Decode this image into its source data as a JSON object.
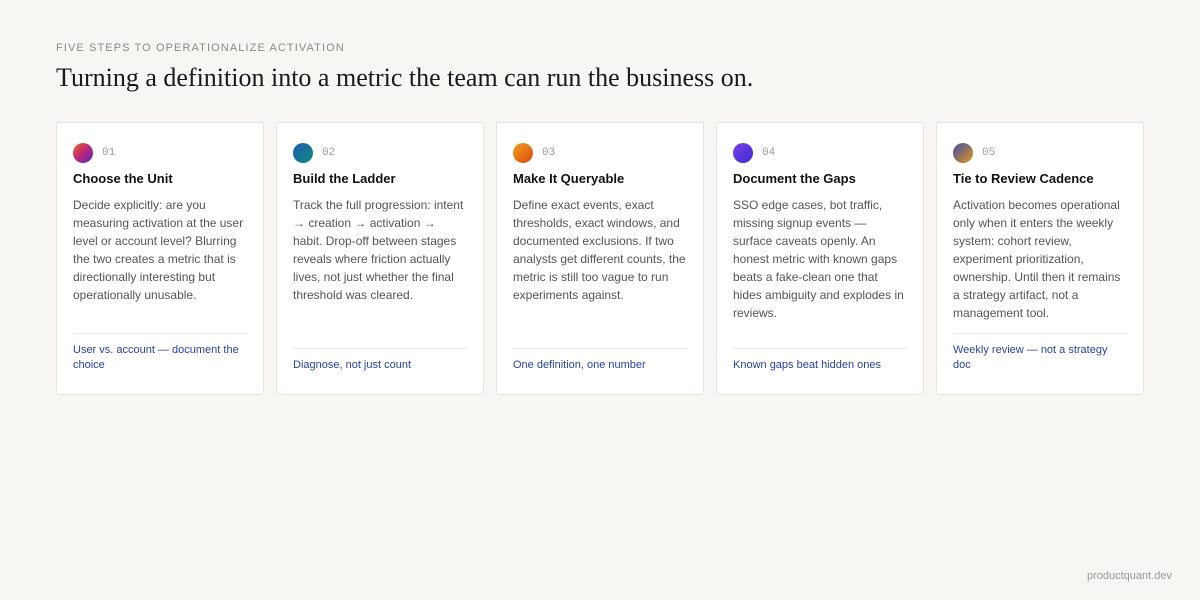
{
  "header": {
    "eyebrow": "FIVE STEPS TO OPERATIONALIZE ACTIVATION",
    "title": "Turning a definition into a metric the team can run the business on."
  },
  "cards": [
    {
      "num": "01",
      "title": "Choose the Unit",
      "body": "Decide explicitly: are you measuring activation at the user level or account level? Blurring the two creates a metric that is directionally interesting but operationally unusable.",
      "footer": "User vs. account — document the choice",
      "gradient": [
        "#e86a17",
        "#c0237a",
        "#4a2fbf"
      ]
    },
    {
      "num": "02",
      "title": "Build the Ladder",
      "body": "Track the full progression: intent → creation → activation → habit. Drop-off between stages reveals where friction actually lives, not just whether the final threshold was cleared.",
      "footer": "Diagnose, not just count",
      "gradient": [
        "#1e5bb8",
        "#0f8a7a"
      ]
    },
    {
      "num": "03",
      "title": "Make It Queryable",
      "body": "Define exact events, exact thresholds, exact windows, and documented exclusions. If two analysts get different counts, the metric is still too vague to run experiments against.",
      "footer": "One definition, one number",
      "gradient": [
        "#f4a11c",
        "#d9480f"
      ]
    },
    {
      "num": "04",
      "title": "Document the Gaps",
      "body": "SSO edge cases, bot traffic, missing signup events — surface caveats openly. An honest metric with known gaps beats a fake-clean one that hides ambiguity and explodes in reviews.",
      "footer": "Known gaps beat hidden ones",
      "gradient": [
        "#7b3fe4",
        "#3b2bd6"
      ]
    },
    {
      "num": "05",
      "title": "Tie to Review Cadence",
      "body": "Activation becomes operational only when it enters the weekly system: cohort review, experiment prioritization, ownership. Until then it remains a strategy artifact, not a management tool.",
      "footer": "Weekly review — not a strategy doc",
      "gradient": [
        "#3a4fb0",
        "#e8951a"
      ]
    }
  ],
  "brand": "productquant.dev"
}
